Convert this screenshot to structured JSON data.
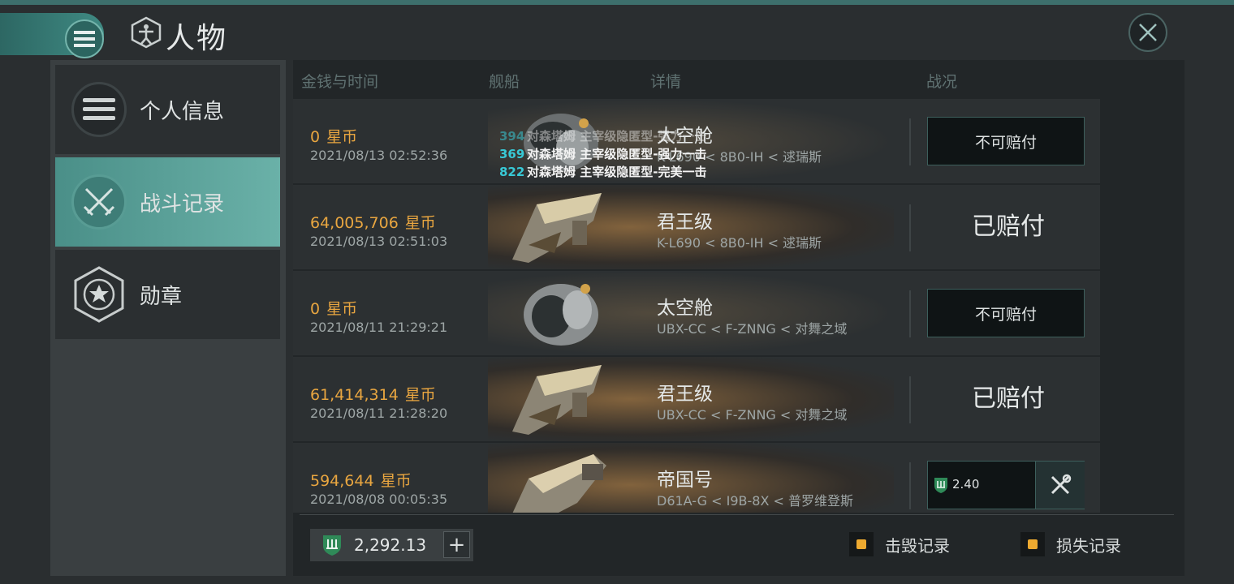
{
  "header": {
    "title": "人物",
    "icons": {
      "menu": "menu-icon",
      "title": "vitruvian-cube-icon",
      "close": "close-icon"
    }
  },
  "sidebar": {
    "items": [
      {
        "label": "个人信息",
        "icon": "list-icon",
        "active": false
      },
      {
        "label": "战斗记录",
        "icon": "crossed-swords-icon",
        "active": true
      },
      {
        "label": "勋章",
        "icon": "star-hexagon-icon",
        "active": false
      }
    ]
  },
  "table": {
    "columns": [
      "金钱与时间",
      "舰船",
      "详情",
      "战况"
    ],
    "rows": [
      {
        "amount": "0",
        "currency": "星币",
        "time": "2021/08/13  02:52:36",
        "ship": "太空舱",
        "location": "K-L690 < 8B0-IH < 逑瑞斯",
        "status": "不可赔付",
        "status_style": "box"
      },
      {
        "amount": "64,005,706",
        "currency": "星币",
        "time": "2021/08/13  02:51:03",
        "ship": "君王级",
        "location": "K-L690 < 8B0-IH < 逑瑞斯",
        "status": "已赔付",
        "status_style": "text"
      },
      {
        "amount": "0",
        "currency": "星币",
        "time": "2021/08/11  21:29:21",
        "ship": "太空舱",
        "location": "UBX-CC < F-ZNNG < 对舞之域",
        "status": "不可赔付",
        "status_style": "box"
      },
      {
        "amount": "61,414,314",
        "currency": "星币",
        "time": "2021/08/11  21:28:20",
        "ship": "君王级",
        "location": "UBX-CC < F-ZNNG < 对舞之域",
        "status": "已赔付",
        "status_style": "text"
      },
      {
        "amount": "594,644",
        "currency": "星币",
        "time": "2021/08/08  00:05:35",
        "ship": "帝国号",
        "location": "D61A-G < I9B-8X < 普罗维登斯",
        "insurance_value": "2.40",
        "status_style": "insurance"
      }
    ]
  },
  "combat_overlay": [
    {
      "num": "394",
      "text": "对森塔姆 主宰级隐匿型-强力一击"
    },
    {
      "num": "369",
      "text": "对森塔姆 主宰级隐匿型-强力一击"
    },
    {
      "num": "822",
      "text": "对森塔姆 主宰级隐匿型-完美一击"
    }
  ],
  "footer": {
    "balance": "2,292.13",
    "plus_label": "+",
    "legend": [
      {
        "label": "击毁记录"
      },
      {
        "label": "损失记录"
      }
    ]
  },
  "colors": {
    "accent_teal": "#4a8f88",
    "money_gold": "#e9a640",
    "legend_orange": "#eeaa30",
    "overlay_cyan": "#38c9d6"
  }
}
